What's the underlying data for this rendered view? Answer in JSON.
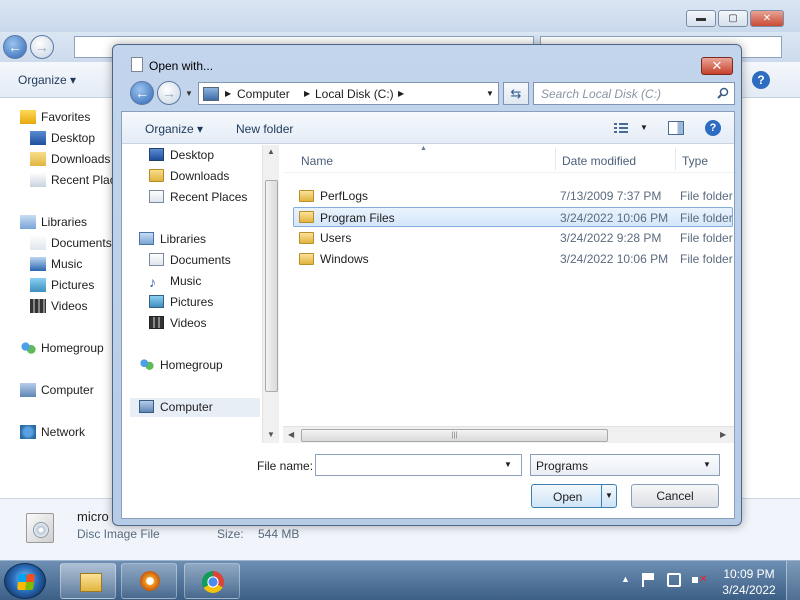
{
  "background_window": {
    "toolbar": {
      "organize_label": "Organize ▾",
      "help_label": "?"
    },
    "controls": {
      "min": "▬",
      "max": "▢",
      "close": "✕"
    },
    "nav_pane": [
      {
        "label": "Favorites",
        "icon": "star-icon",
        "group": true
      },
      {
        "label": "Desktop",
        "icon": "desktop-icon"
      },
      {
        "label": "Downloads",
        "icon": "folder-icon"
      },
      {
        "label": "Recent Plac",
        "icon": "recent-places-icon"
      },
      {
        "label": "Libraries",
        "icon": "libraries-icon",
        "group": true
      },
      {
        "label": "Documents",
        "icon": "documents-icon"
      },
      {
        "label": "Music",
        "icon": "music-icon"
      },
      {
        "label": "Pictures",
        "icon": "pictures-icon"
      },
      {
        "label": "Videos",
        "icon": "videos-icon"
      },
      {
        "label": "Homegroup",
        "icon": "homegroup-icon",
        "group": true
      },
      {
        "label": "Computer",
        "icon": "computer-icon",
        "group": true
      },
      {
        "label": "Network",
        "icon": "network-icon",
        "group": true
      }
    ],
    "details": {
      "name": "micro",
      "type": "Disc Image File",
      "size_label": "Size:",
      "size_value": "544 MB"
    }
  },
  "dialog": {
    "title": "Open with...",
    "close_label": "✕",
    "address": {
      "crumbs": [
        "Computer",
        "Local Disk (C:)"
      ]
    },
    "refresh_label": "⇆",
    "search_placeholder": "Search Local Disk (C:)",
    "toolbar": {
      "organize_label": "Organize ▾",
      "new_folder_label": "New folder",
      "help_label": "?"
    },
    "nav_pane": {
      "items": [
        {
          "label": "Desktop",
          "icon": "desktop-icon"
        },
        {
          "label": "Downloads",
          "icon": "folder-icon"
        },
        {
          "label": "Recent Places",
          "icon": "recent-places-icon"
        },
        {
          "label": "Libraries",
          "icon": "libraries-icon",
          "group": true
        },
        {
          "label": "Documents",
          "icon": "documents-icon"
        },
        {
          "label": "Music",
          "icon": "music-icon"
        },
        {
          "label": "Pictures",
          "icon": "pictures-icon"
        },
        {
          "label": "Videos",
          "icon": "videos-icon"
        },
        {
          "label": "Homegroup",
          "icon": "homegroup-icon",
          "group": true
        },
        {
          "label": "Computer",
          "icon": "computer-icon",
          "group": true,
          "selected": true
        }
      ]
    },
    "columns": {
      "name": "Name",
      "date": "Date modified",
      "type": "Type"
    },
    "files": [
      {
        "name": "PerfLogs",
        "date": "7/13/2009 7:37 PM",
        "type": "File folder",
        "selected": false
      },
      {
        "name": "Program Files",
        "date": "3/24/2022 10:06 PM",
        "type": "File folder",
        "selected": true
      },
      {
        "name": "Users",
        "date": "3/24/2022 9:28 PM",
        "type": "File folder",
        "selected": false
      },
      {
        "name": "Windows",
        "date": "3/24/2022 10:06 PM",
        "type": "File folder",
        "selected": false
      }
    ],
    "filename_label": "File name:",
    "filename_value": "",
    "filetype_value": "Programs",
    "open_label": "Open",
    "cancel_label": "Cancel"
  },
  "taskbar": {
    "time": "10:09 PM",
    "date": "3/24/2022"
  }
}
